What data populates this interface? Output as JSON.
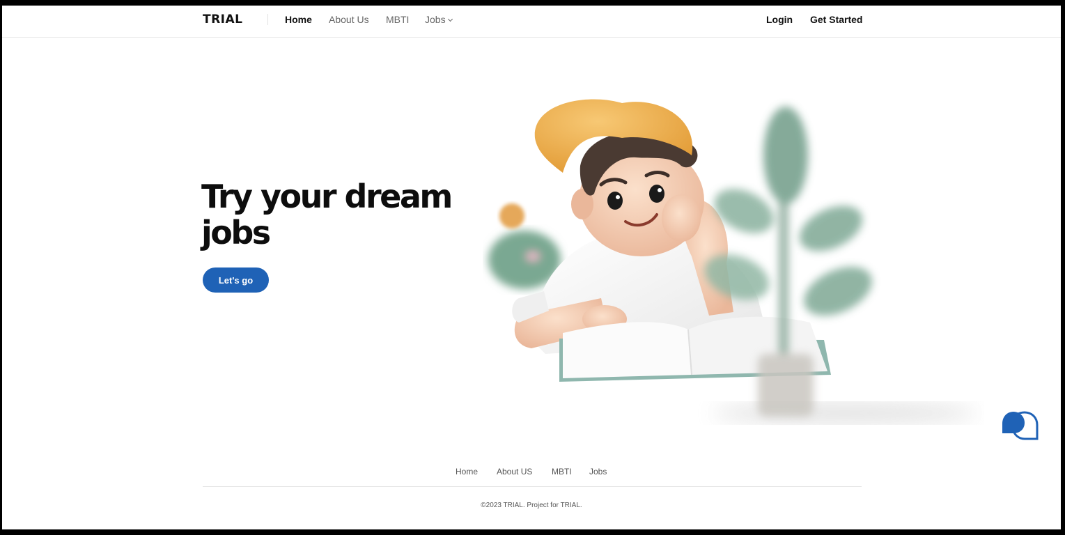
{
  "nav": {
    "logo": "TRIAL",
    "links": [
      {
        "label": "Home"
      },
      {
        "label": "About Us"
      },
      {
        "label": "MBTI"
      },
      {
        "label": "Jobs"
      }
    ],
    "login": "Login",
    "get_started": "Get Started"
  },
  "hero": {
    "title_line1": "Try your dream",
    "title_line2": "jobs",
    "cta": "Let's go"
  },
  "footer": {
    "links": [
      {
        "label": "Home"
      },
      {
        "label": "About US"
      },
      {
        "label": "MBTI"
      },
      {
        "label": "Jobs"
      }
    ],
    "copyright": "©2023 TRIAL. Project for TRIAL."
  },
  "colors": {
    "accent": "#1f62b6",
    "text": "#111111",
    "cap": "#f2b24a",
    "plant": "#7fa793"
  },
  "icons": {
    "chat": "chat-bubbles-icon",
    "jobs_dropdown": "chevron-down-icon"
  }
}
